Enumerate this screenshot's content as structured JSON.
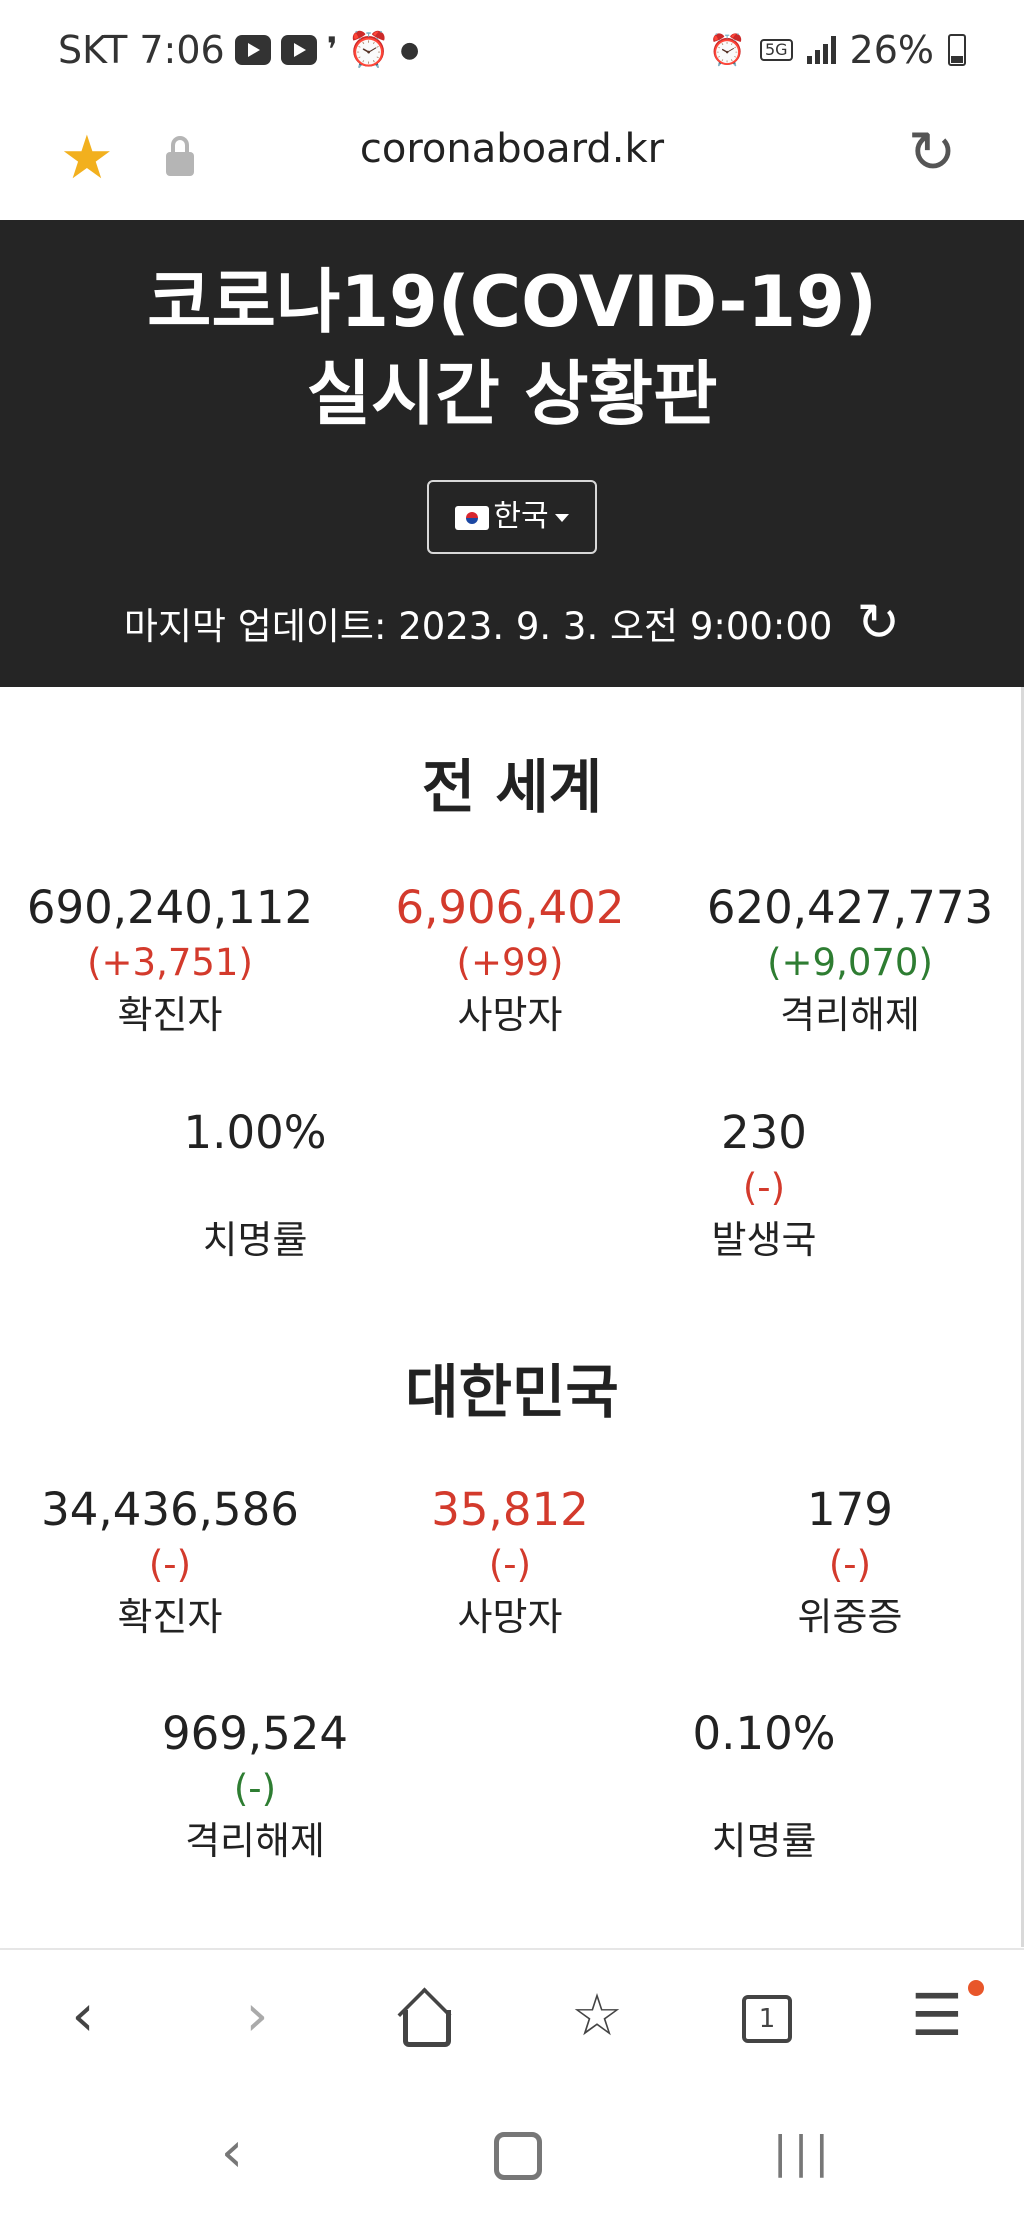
{
  "status_bar": {
    "carrier_time": "SKT 7:06",
    "network_badge": "5G",
    "battery": "26%",
    "left_icons": [
      "youtube-icon",
      "youtube-icon",
      "quote-icon",
      "alarm-icon",
      "dot-icon"
    ],
    "right_icons": [
      "alarm-icon",
      "5g-icon",
      "signal-icon",
      "battery-icon"
    ]
  },
  "browser": {
    "url": "coronaboard.kr",
    "bookmark_color": "#f2b01e"
  },
  "header": {
    "title_line1": "코로나19(COVID-19)",
    "title_line2": "실시간 상황판",
    "language": "한국",
    "last_update": "마지막 업데이트: 2023. 9. 3. 오전 9:00:00",
    "background": "#252525"
  },
  "world": {
    "title": "전 세계",
    "confirmed": {
      "value": "690,240,112",
      "delta": "(+3,751)",
      "label": "확진자"
    },
    "deaths": {
      "value": "6,906,402",
      "delta": "(+99)",
      "label": "사망자"
    },
    "released": {
      "value": "620,427,773",
      "delta": "(+9,070)",
      "label": "격리해제"
    },
    "fatality": {
      "value": "1.00%",
      "label": "치명률"
    },
    "countries": {
      "value": "230",
      "delta": "(-)",
      "label": "발생국"
    }
  },
  "korea": {
    "title": "대한민국",
    "confirmed": {
      "value": "34,436,586",
      "delta": "(-)",
      "label": "확진자"
    },
    "deaths": {
      "value": "35,812",
      "delta": "(-)",
      "label": "사망자"
    },
    "critical": {
      "value": "179",
      "delta": "(-)",
      "label": "위중증"
    },
    "released": {
      "value": "969,524",
      "delta": "(-)",
      "label": "격리해제"
    },
    "fatality": {
      "value": "0.10%",
      "label": "치명률"
    }
  },
  "colors": {
    "increase_red": "#d33a2c",
    "release_green": "#2e7d32",
    "notification_dot": "#e8562a"
  },
  "toolbar": {
    "tab_count": "1",
    "buttons": [
      "back-icon",
      "forward-icon",
      "home-icon",
      "bookmarks-icon",
      "tabs-icon",
      "menu-icon"
    ]
  },
  "navigation": [
    "back-icon",
    "home-icon",
    "recents-icon"
  ]
}
